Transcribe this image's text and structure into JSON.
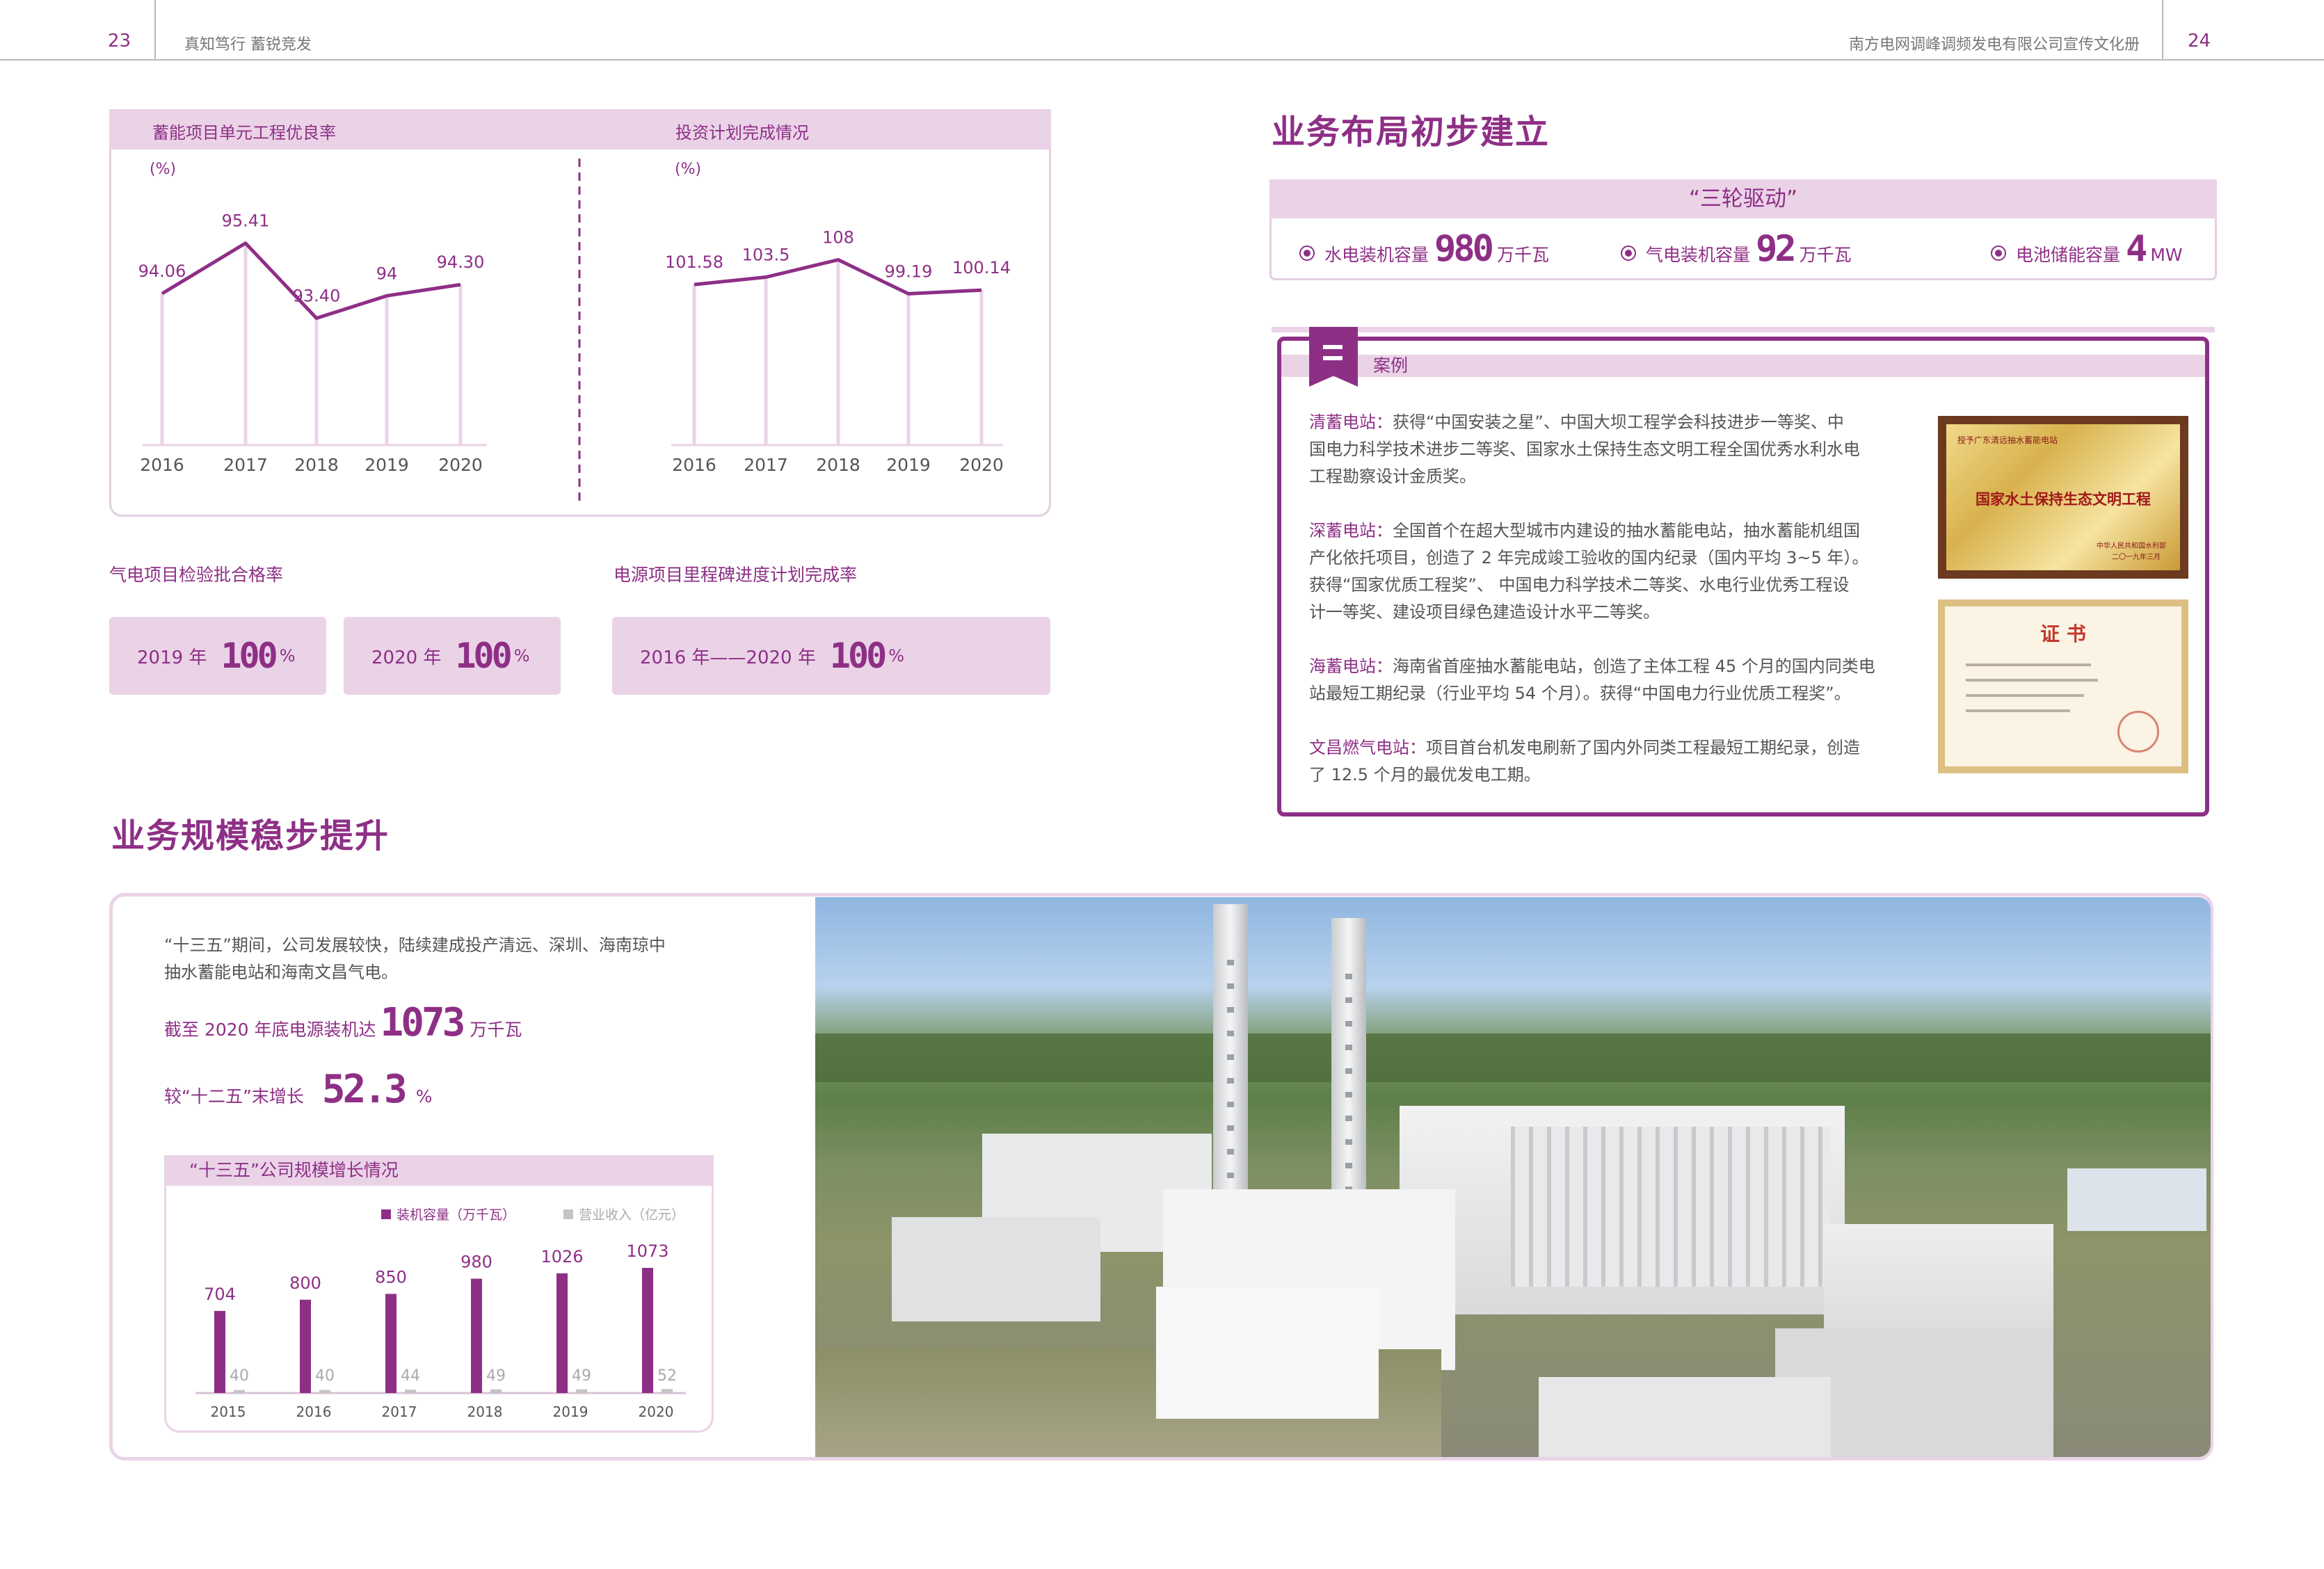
{
  "header": {
    "left_page": "23",
    "left_title": "真知笃行 蓄锐竞发",
    "right_title": "南方电网调峰调频发电有限公司宣传文化册",
    "right_page": "24"
  },
  "chart_panel": {
    "left_title": "蓄能项目单元工程优良率",
    "right_title": "投资计划完成情况"
  },
  "chart_data": [
    {
      "type": "line",
      "title": "蓄能项目单元工程优良率",
      "ylabel": "(%)",
      "categories": [
        "2016",
        "2017",
        "2018",
        "2019",
        "2020"
      ],
      "values": [
        94.06,
        95.41,
        93.4,
        94,
        94.3
      ],
      "value_labels": [
        "94.06",
        "95.41",
        "93.40",
        "94",
        "94.30"
      ],
      "ylim": [
        90,
        96
      ],
      "grid": false
    },
    {
      "type": "line",
      "title": "投资计划完成情况",
      "ylabel": "(%)",
      "categories": [
        "2016",
        "2017",
        "2018",
        "2019",
        "2020"
      ],
      "values": [
        101.58,
        103.5,
        108,
        99.19,
        100.14
      ],
      "value_labels": [
        "101.58",
        "103.5",
        "108",
        "99.19",
        "100.14"
      ],
      "ylim": [
        60,
        118
      ],
      "grid": false
    },
    {
      "type": "bar",
      "title": "“十三五”公司规模增长情况",
      "categories": [
        "2015",
        "2016",
        "2017",
        "2018",
        "2019",
        "2020"
      ],
      "series": [
        {
          "name": "装机容量（万千瓦）",
          "values": [
            704,
            800,
            850,
            980,
            1026,
            1073
          ],
          "color": "#8e2f86"
        },
        {
          "name": "营业收入（亿元）",
          "values": [
            40,
            40,
            44,
            49,
            49,
            52
          ],
          "color": "#c4c4c4"
        }
      ],
      "legend": "top-right",
      "grid": false
    }
  ],
  "quality": {
    "gas_title": "气电项目检验批合格率",
    "power_title": "电源项目里程碑进度计划完成率",
    "boxes": [
      {
        "label": "2019 年",
        "value": "100",
        "unit": "%"
      },
      {
        "label": "2020 年",
        "value": "100",
        "unit": "%"
      },
      {
        "label": "2016 年——2020 年",
        "value": "100",
        "unit": "%"
      }
    ]
  },
  "layout_section": {
    "title": "业务布局初步建立",
    "subtitle": "“三轮驱动”",
    "items": [
      {
        "label": "水电装机容量",
        "value": "980",
        "unit": "万千瓦"
      },
      {
        "label": "气电装机容量",
        "value": "92",
        "unit": "万千瓦"
      },
      {
        "label": "电池储能容量",
        "value": "4",
        "unit": "MW"
      }
    ]
  },
  "case": {
    "tag": "案例",
    "paragraphs": [
      {
        "key": "清蓄电站：",
        "lines": [
          "获得“中国安装之星”、中国大坝工程学会科技进步一等奖、中",
          "国电力科学技术进步二等奖、国家水土保持生态文明工程全国优秀水利水电",
          "工程勘察设计金质奖。"
        ]
      },
      {
        "key": "深蓄电站：",
        "lines": [
          "全国首个在超大型城市内建设的抽水蓄能电站，抽水蓄能机组国",
          "产化依托项目，创造了 2 年完成竣工验收的国内纪录（国内平均 3~5 年）。",
          "获得“国家优质工程奖”、 中国电力科学技术二等奖、水电行业优秀工程设",
          "计一等奖、建设项目绿色建造设计水平二等奖。"
        ]
      },
      {
        "key": "海蓄电站：",
        "lines": [
          "海南省首座抽水蓄能电站，创造了主体工程 45 个月的国内同类电",
          "站最短工期纪录（行业平均 54 个月）。获得“中国电力行业优质工程奖”。"
        ]
      },
      {
        "key": "文昌燃气电站：",
        "lines": [
          "项目首台机发电刷新了国内外同类工程最短工期纪录，创造",
          "了 12.5 个月的最优发电工期。"
        ]
      }
    ],
    "plaque_header": "授予广东清远抽水蓄能电站",
    "plaque_text": "国家水土保持生态文明工程",
    "plaque_issuer": "中华人民共和国水利部",
    "plaque_date": "二〇一九年三月",
    "cert_title": "证  书"
  },
  "scale_section": {
    "title": "业务规模稳步提升",
    "intro_lines": [
      "“十三五”期间，公司发展较快，陆续建成投产清远、深圳、海南琼中",
      "抽水蓄能电站和海南文昌气电。"
    ],
    "stat1_prefix": "截至 2020 年底电源装机达",
    "stat1_value": "1073",
    "stat1_unit": "万千瓦",
    "stat2_prefix": "较“十二五”末增长",
    "stat2_value": "52.3",
    "stat2_unit": "%",
    "chart_title": "“十三五”公司规模增长情况"
  },
  "colors": {
    "accent": "#8e2f86",
    "panel": "#ead3e7",
    "border": "#e3cfe1",
    "bar_gray": "#c4c4c4"
  }
}
